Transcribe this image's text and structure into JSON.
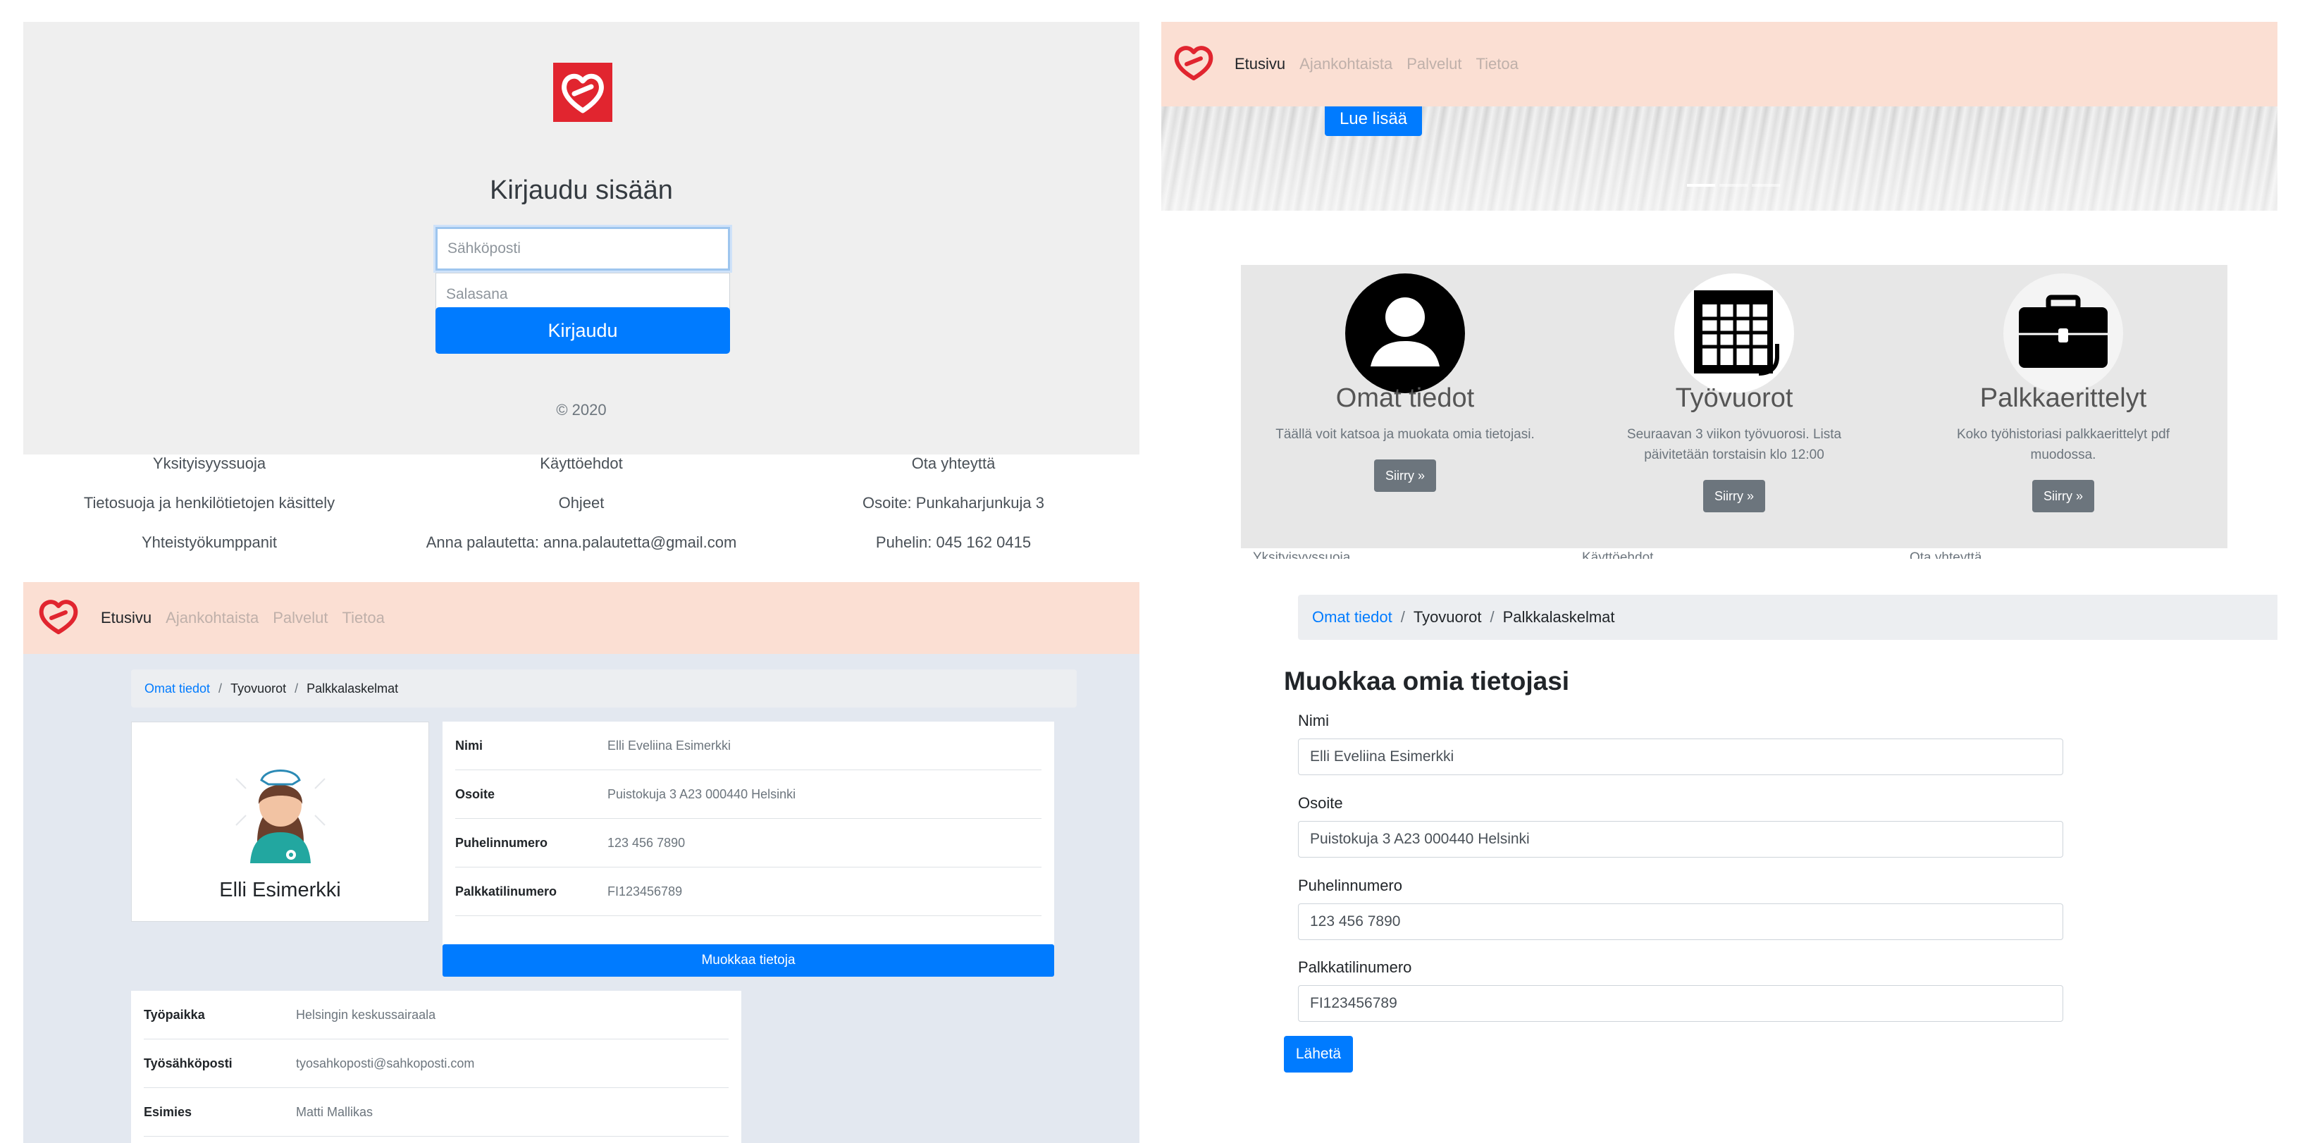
{
  "colors": {
    "brand_red": "#e1252f",
    "primary": "#007bff",
    "navbar_bg": "#fbdfd3",
    "secondary": "#6c757d"
  },
  "login": {
    "title": "Kirjaudu sisään",
    "email_placeholder": "Sähköposti",
    "password_placeholder": "Salasana",
    "submit_label": "Kirjaudu",
    "copyright": "© 2020"
  },
  "footer": {
    "col1": [
      "Yksityisyyssuoja",
      "Tietosuoja ja henkilötietojen käsittely",
      "Yhteistyökumppanit"
    ],
    "col2": [
      "Käyttöehdot",
      "Ohjeet",
      "Anna palautetta: anna.palautetta@gmail.com"
    ],
    "col3": [
      "Ota yhteyttä",
      "Osoite: Punkaharjunkuja 3",
      "Puhelin: 045 162 0415"
    ]
  },
  "nav": {
    "items": [
      "Etusivu",
      "Ajankohtaista",
      "Palvelut",
      "Tietoa"
    ],
    "logo_icon": "heart-logo-icon"
  },
  "home": {
    "read_more_label": "Lue lisää",
    "features": [
      {
        "icon": "user-circle-icon",
        "title": "Omat tiedot",
        "text": "Täällä voit katsoa ja muokata omia tietojasi.",
        "button": "Siirry »"
      },
      {
        "icon": "calendar-icon",
        "title": "Työvuorot",
        "text": "Seuraavan 3 viikon työvuorosi. Lista päivitetään torstaisin klo 12:00",
        "button": "Siirry »"
      },
      {
        "icon": "briefcase-icon",
        "title": "Palkkaerittelyt",
        "text": "Koko työhistoriasi palkkaerittelyt pdf muodossa.",
        "button": "Siirry »"
      }
    ],
    "footer_peek": [
      "Yksityisyyssuoja",
      "Käyttöehdot",
      "Ota yhteyttä"
    ]
  },
  "breadcrumb": {
    "items": [
      "Omat tiedot",
      "Tyovuorot",
      "Palkkalaskelmat"
    ]
  },
  "profile": {
    "name": "Elli Esimerkki",
    "avatar_icon": "nurse-avatar-icon",
    "info": [
      {
        "label": "Nimi",
        "value": "Elli Eveliina Esimerkki"
      },
      {
        "label": "Osoite",
        "value": "Puistokuja 3 A23 000440 Helsinki"
      },
      {
        "label": "Puhelinnumero",
        "value": "123 456 7890"
      },
      {
        "label": "Palkkatilinumero",
        "value": "FI123456789"
      }
    ],
    "edit_button": "Muokkaa tietoja",
    "work": [
      {
        "label": "Työpaikka",
        "value": "Helsingin keskussairaala"
      },
      {
        "label": "Työsähköposti",
        "value": "tyosahkoposti@sahkoposti.com"
      },
      {
        "label": "Esimies",
        "value": "Matti Mallikas"
      }
    ]
  },
  "edit": {
    "title": "Muokkaa omia tietojasi",
    "fields": [
      {
        "label": "Nimi",
        "value": "Elli Eveliina Esimerkki"
      },
      {
        "label": "Osoite",
        "value": "Puistokuja 3 A23 000440 Helsinki"
      },
      {
        "label": "Puhelinnumero",
        "value": "123 456 7890"
      },
      {
        "label": "Palkkatilinumero",
        "value": "FI123456789"
      }
    ],
    "submit_label": "Lähetä"
  }
}
